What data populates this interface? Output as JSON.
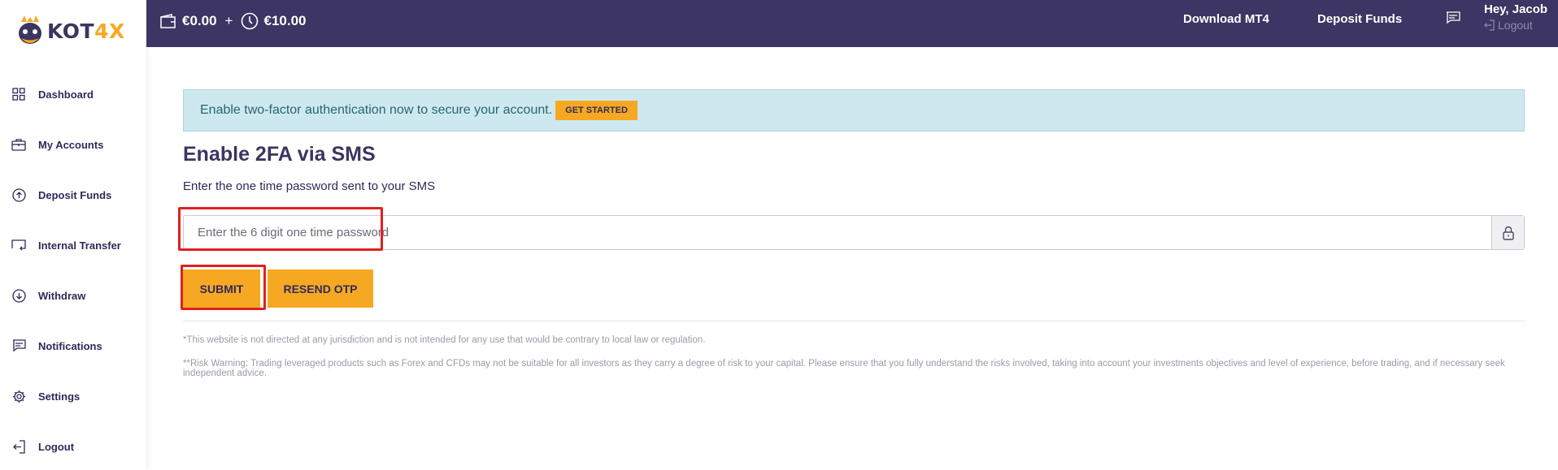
{
  "brand": {
    "name_part1": "KOT",
    "name_part2": "4X",
    "accent_color": "#f7a823",
    "header_color": "#3d3563"
  },
  "sidebar": {
    "items": [
      {
        "label": "Dashboard",
        "icon": "grid-icon"
      },
      {
        "label": "My Accounts",
        "icon": "briefcase-icon"
      },
      {
        "label": "Deposit Funds",
        "icon": "arrow-up-circle-icon"
      },
      {
        "label": "Internal Transfer",
        "icon": "transfer-icon"
      },
      {
        "label": "Withdraw",
        "icon": "arrow-down-circle-icon"
      },
      {
        "label": "Notifications",
        "icon": "message-icon"
      },
      {
        "label": "Settings",
        "icon": "gear-icon"
      },
      {
        "label": "Logout",
        "icon": "logout-icon"
      }
    ]
  },
  "header": {
    "balance": "€0.00",
    "plus": "+",
    "bonus": "€10.00",
    "download_label": "Download MT4",
    "deposit_label": "Deposit Funds",
    "greeting": "Hey, Jacob",
    "logout_label": "Logout"
  },
  "alert": {
    "text": "Enable two-factor authentication now to secure your account.",
    "button_label": "GET STARTED"
  },
  "form": {
    "title": "Enable 2FA via SMS",
    "subtitle": "Enter the one time password sent to your SMS",
    "otp_value": "",
    "otp_placeholder": "Enter the 6 digit one time password",
    "submit_label": "SUBMIT",
    "resend_label": "RESEND OTP"
  },
  "disclaimer": {
    "line1": "*This website is not directed at any jurisdiction and is not intended for any use that would be contrary to local law or regulation.",
    "line2": "**Risk Warning: Trading leveraged products such as Forex and CFDs may not be suitable for all investors as they carry a degree of risk to your capital. Please ensure that you fully understand the risks involved, taking into account your investments objectives and level of experience, before trading, and if necessary seek independent advice."
  }
}
